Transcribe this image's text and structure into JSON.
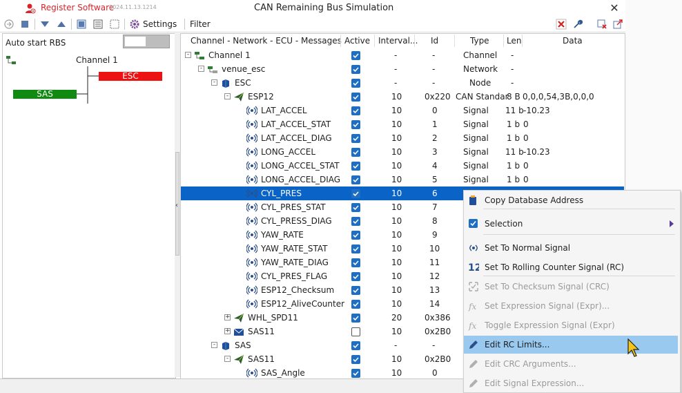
{
  "title_bar": {
    "register_label": "Register Software",
    "version": "2024.11.13.1214",
    "app_title": "CAN Remaining Bus Simulation",
    "close_glyph": "✕"
  },
  "toolbar": {
    "settings_label": "Settings",
    "filter_label": "Filter",
    "buttons": [
      "record-icon",
      "stop-icon",
      "collapse-all-icon",
      "expand-all-icon",
      "view-a-icon",
      "view-b-icon",
      "view-c-icon",
      "gear-icon",
      "clear-filter-icon",
      "wrench-icon",
      "delete-icon",
      "export-icon"
    ]
  },
  "left_pane": {
    "auto_start_label": "Auto start RBS",
    "auto_start_on": false,
    "diagram": {
      "channel_label": "Channel 1",
      "nodes": [
        {
          "name": "ESC",
          "color": "#ee1111"
        },
        {
          "name": "SAS",
          "color": "#118a11"
        }
      ]
    }
  },
  "columns": [
    "Channel - Network - ECU - Messages",
    "Active",
    "Interval...",
    "Id",
    "Type",
    "Len",
    "Data"
  ],
  "tree": [
    {
      "depth": 0,
      "exp": "-",
      "icon": "channel",
      "label": "Channel 1",
      "active": true,
      "interval": "-",
      "id": "-",
      "type": "Channel",
      "len": "-",
      "data": ""
    },
    {
      "depth": 1,
      "exp": "-",
      "icon": "network",
      "label": "venue_esc",
      "active": true,
      "interval": "-",
      "id": "-",
      "type": "Network",
      "len": "-",
      "data": ""
    },
    {
      "depth": 2,
      "exp": "-",
      "icon": "node",
      "label": "ESC",
      "active": true,
      "interval": "-",
      "id": "-",
      "type": "Node",
      "len": "-",
      "data": ""
    },
    {
      "depth": 3,
      "exp": "-",
      "icon": "message",
      "label": "ESP12",
      "active": true,
      "interval": "10",
      "id": "0x220",
      "type": "CAN Standar",
      "len": "8 B",
      "data": "0,0,0,54,3B,0,0,0"
    },
    {
      "depth": 4,
      "exp": "",
      "icon": "signal",
      "label": "LAT_ACCEL",
      "active": true,
      "interval": "10",
      "id": "0",
      "type": "Signal",
      "len": "11 b",
      "data": "-10.23"
    },
    {
      "depth": 4,
      "exp": "",
      "icon": "signal",
      "label": "LAT_ACCEL_STAT",
      "active": true,
      "interval": "10",
      "id": "1",
      "type": "Signal",
      "len": "1 b",
      "data": "0"
    },
    {
      "depth": 4,
      "exp": "",
      "icon": "signal",
      "label": "LAT_ACCEL_DIAG",
      "active": true,
      "interval": "10",
      "id": "2",
      "type": "Signal",
      "len": "1 b",
      "data": "0"
    },
    {
      "depth": 4,
      "exp": "",
      "icon": "signal",
      "label": "LONG_ACCEL",
      "active": true,
      "interval": "10",
      "id": "3",
      "type": "Signal",
      "len": "11 b",
      "data": "-10.23"
    },
    {
      "depth": 4,
      "exp": "",
      "icon": "signal",
      "label": "LONG_ACCEL_STAT",
      "active": true,
      "interval": "10",
      "id": "4",
      "type": "Signal",
      "len": "1 b",
      "data": "0"
    },
    {
      "depth": 4,
      "exp": "",
      "icon": "signal",
      "label": "LONG_ACCEL_DIAG",
      "active": true,
      "interval": "10",
      "id": "5",
      "type": "Signal",
      "len": "1 b",
      "data": "0"
    },
    {
      "depth": 4,
      "exp": "",
      "icon": "signal",
      "label": "CYL_PRES",
      "active": true,
      "interval": "10",
      "id": "6",
      "type": "",
      "len": "",
      "data": "",
      "selected": true
    },
    {
      "depth": 4,
      "exp": "",
      "icon": "signal",
      "label": "CYL_PRES_STAT",
      "active": true,
      "interval": "10",
      "id": "7",
      "type": "",
      "len": "",
      "data": ""
    },
    {
      "depth": 4,
      "exp": "",
      "icon": "signal",
      "label": "CYL_PRESS_DIAG",
      "active": true,
      "interval": "10",
      "id": "8",
      "type": "",
      "len": "",
      "data": ""
    },
    {
      "depth": 4,
      "exp": "",
      "icon": "signal",
      "label": "YAW_RATE",
      "active": true,
      "interval": "10",
      "id": "9",
      "type": "",
      "len": "",
      "data": ""
    },
    {
      "depth": 4,
      "exp": "",
      "icon": "signal",
      "label": "YAW_RATE_STAT",
      "active": true,
      "interval": "10",
      "id": "10",
      "type": "",
      "len": "",
      "data": ""
    },
    {
      "depth": 4,
      "exp": "",
      "icon": "signal",
      "label": "YAW_RATE_DIAG",
      "active": true,
      "interval": "10",
      "id": "11",
      "type": "",
      "len": "",
      "data": ""
    },
    {
      "depth": 4,
      "exp": "",
      "icon": "signal",
      "label": "CYL_PRES_FLAG",
      "active": true,
      "interval": "10",
      "id": "12",
      "type": "",
      "len": "",
      "data": ""
    },
    {
      "depth": 4,
      "exp": "",
      "icon": "signal",
      "label": "ESP12_Checksum",
      "active": true,
      "interval": "10",
      "id": "13",
      "type": "",
      "len": "",
      "data": ""
    },
    {
      "depth": 4,
      "exp": "",
      "icon": "signal",
      "label": "ESP12_AliveCounter",
      "active": true,
      "interval": "10",
      "id": "14",
      "type": "",
      "len": "",
      "data": ""
    },
    {
      "depth": 3,
      "exp": "+",
      "icon": "message",
      "label": "WHL_SPD11",
      "active": true,
      "interval": "20",
      "id": "0x386",
      "type": "CA",
      "len": "",
      "data": ""
    },
    {
      "depth": 3,
      "exp": "+",
      "icon": "envelope",
      "label": "SAS11",
      "active": false,
      "interval": "10",
      "id": "0x2B0",
      "type": "CA",
      "len": "",
      "data": ""
    },
    {
      "depth": 2,
      "exp": "-",
      "icon": "node",
      "label": "SAS",
      "active": true,
      "interval": "-",
      "id": "-",
      "type": "",
      "len": "",
      "data": ""
    },
    {
      "depth": 3,
      "exp": "-",
      "icon": "message",
      "label": "SAS11",
      "active": true,
      "interval": "10",
      "id": "0x2B0",
      "type": "CA",
      "len": "",
      "data": ""
    },
    {
      "depth": 4,
      "exp": "",
      "icon": "signal",
      "label": "SAS_Angle",
      "active": true,
      "interval": "10",
      "id": "0",
      "type": "",
      "len": "",
      "data": ""
    }
  ],
  "context_menu": {
    "items": [
      {
        "label": "Copy Database Address",
        "icon": "copy-icon",
        "disabled": false
      },
      {
        "label": "Selection",
        "icon": "checkbox-icon",
        "disabled": false,
        "submenu": true
      },
      {
        "label": "Set To Normal Signal",
        "icon": "signal-icon",
        "disabled": false
      },
      {
        "label": "Set To Rolling Counter Signal (RC)",
        "icon": "counter-icon",
        "disabled": false
      },
      {
        "label": "Set To Checksum Signal (CRC)",
        "icon": "checksum-icon",
        "disabled": true
      },
      {
        "label": "Set Expression Signal (Expr)...",
        "icon": "fx-icon",
        "disabled": true
      },
      {
        "label": "Toggle Expression Signal (Expr)",
        "icon": "fx-icon",
        "disabled": true
      },
      {
        "label": "Edit RC Limits...",
        "icon": "pencil-icon",
        "disabled": false,
        "highlighted": true
      },
      {
        "label": "Edit CRC Arguments...",
        "icon": "pencil-icon",
        "disabled": true
      },
      {
        "label": "Edit Signal Expression...",
        "icon": "pencil-icon",
        "disabled": true
      }
    ]
  },
  "colors": {
    "accent": "#d6242a",
    "selection": "#0a64c8",
    "menu_highlight": "#99c9ef",
    "checkbox": "#1e6fc3"
  }
}
